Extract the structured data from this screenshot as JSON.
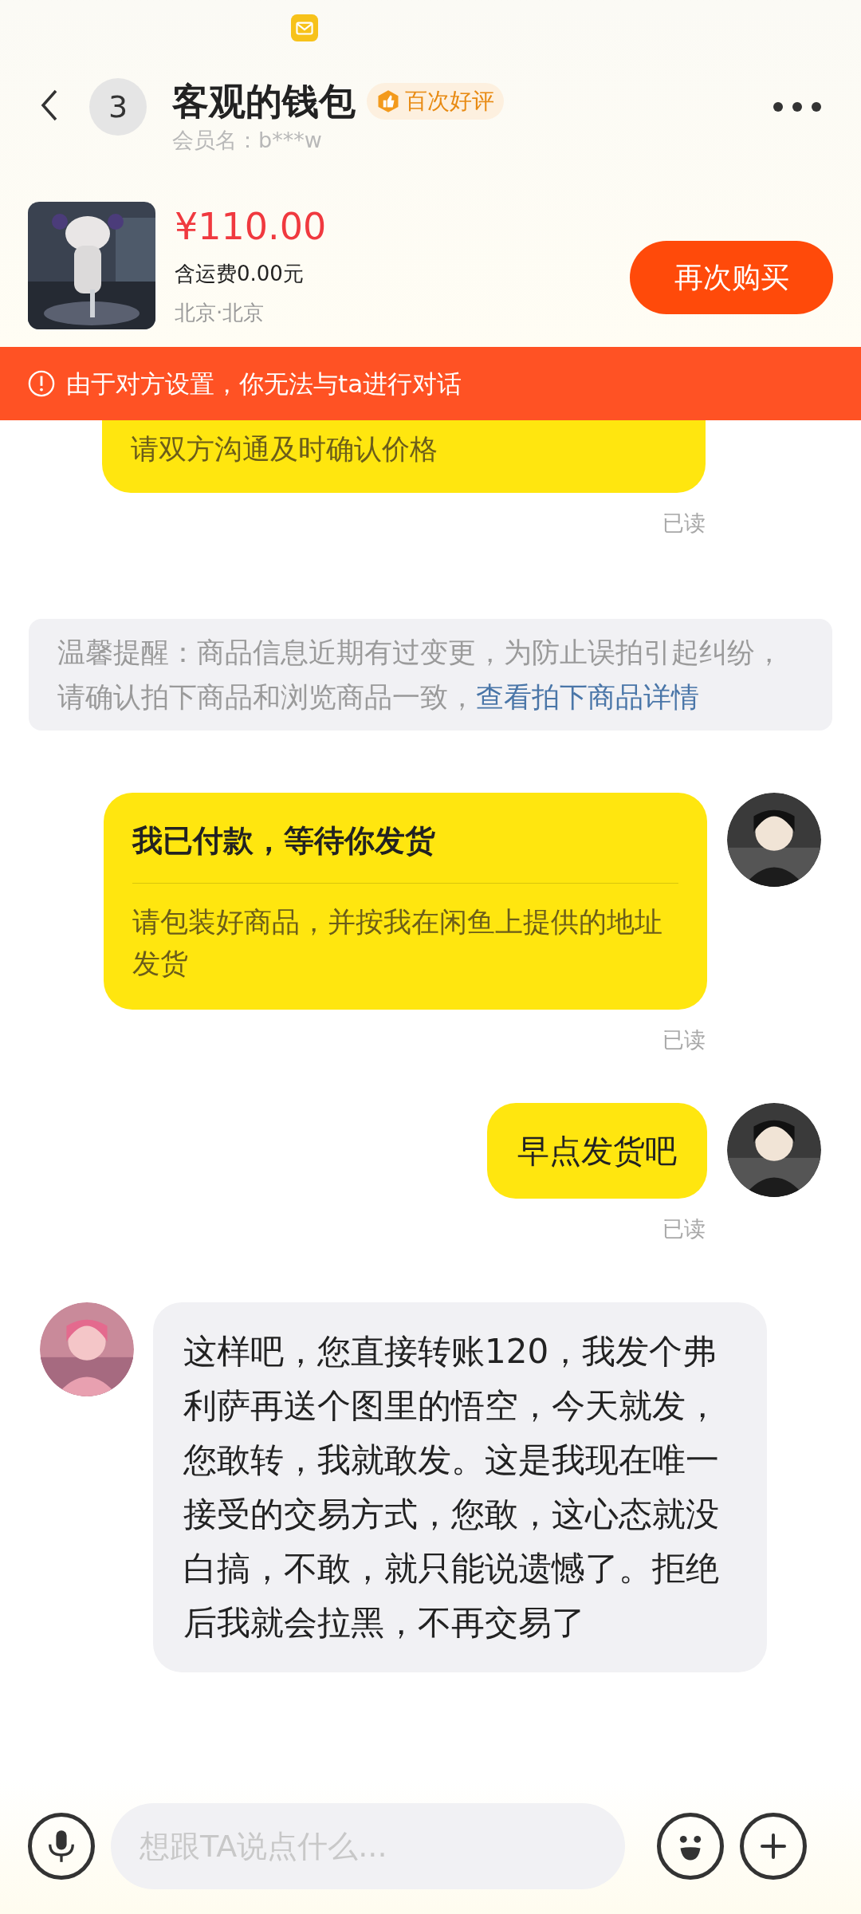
{
  "header": {
    "unread_count": "3",
    "title": "客观的钱包",
    "badge": "百次好评",
    "member": "会员名：b***w"
  },
  "product": {
    "price": "¥110.00",
    "shipping": "含运费0.00元",
    "location": "北京·北京",
    "button": "再次购买"
  },
  "banner": {
    "text": "由于对方设置，你无法与ta进行对话"
  },
  "messages": [
    {
      "kind": "outgoing_card_cut",
      "body": "请双方沟通及时确认价格",
      "status": "已读"
    },
    {
      "kind": "notice",
      "text": "温馨提醒：商品信息近期有过变更，为防止误拍引起纠纷，请确认拍下商品和浏览商品一致，",
      "link": "查看拍下商品详情"
    },
    {
      "kind": "outgoing_card",
      "title": "我已付款，等待你发货",
      "body": "请包装好商品，并按我在闲鱼上提供的地址发货",
      "status": "已读"
    },
    {
      "kind": "outgoing",
      "text": "早点发货吧",
      "status": "已读"
    },
    {
      "kind": "incoming",
      "text": "这样吧，您直接转账120，我发个弗利萨再送个图里的悟空，今天就发，您敢转，我就敢发。这是我现在唯一接受的交易方式，您敢，这心态就没白搞，不敢，就只能说遗憾了。拒绝后我就会拉黑，不再交易了"
    }
  ],
  "input": {
    "placeholder": "想跟TA说点什么..."
  }
}
